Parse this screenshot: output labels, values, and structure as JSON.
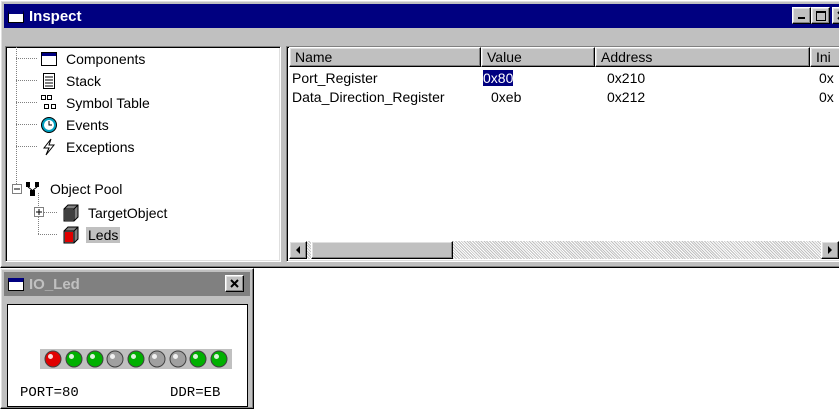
{
  "inspect": {
    "title": "Inspect",
    "tree": [
      {
        "label": "Components",
        "icon": "window-icon",
        "selected": false
      },
      {
        "label": "Stack",
        "icon": "stack-icon",
        "selected": false
      },
      {
        "label": "Symbol Table",
        "icon": "symbol-table-icon",
        "selected": false
      },
      {
        "label": "Events",
        "icon": "clock-icon",
        "selected": false
      },
      {
        "label": "Exceptions",
        "icon": "lightning-icon",
        "selected": false
      },
      {
        "label": "Object Pool",
        "icon": "object-pool-icon",
        "expanded": true,
        "selected": false
      },
      {
        "label": "TargetObject",
        "icon": "cube-gray-icon",
        "expanded": false,
        "selected": false
      },
      {
        "label": "Leds",
        "icon": "cube-red-icon",
        "selected": true
      }
    ],
    "columns": [
      "Name",
      "Value",
      "Address",
      "Ini"
    ],
    "rows": [
      {
        "name": "Port_Register",
        "value": "0x80",
        "address": "0x210",
        "ini": "0x",
        "selected_value": true
      },
      {
        "name": "Data_Direction_Register",
        "value": "0xeb",
        "address": "0x212",
        "ini": "0x",
        "selected_value": false
      }
    ]
  },
  "ioled": {
    "title": "IO_Led",
    "leds": [
      "red",
      "green",
      "green",
      "gray",
      "green",
      "gray",
      "gray",
      "green",
      "green"
    ],
    "port_text": "PORT=80",
    "ddr_text": "DDR=EB"
  },
  "colors": {
    "title_active": "#000080",
    "title_inactive": "#808080",
    "face": "#c0c0c0",
    "led_red": "#e00000",
    "led_green": "#00b000",
    "led_gray": "#a0a0a0"
  }
}
